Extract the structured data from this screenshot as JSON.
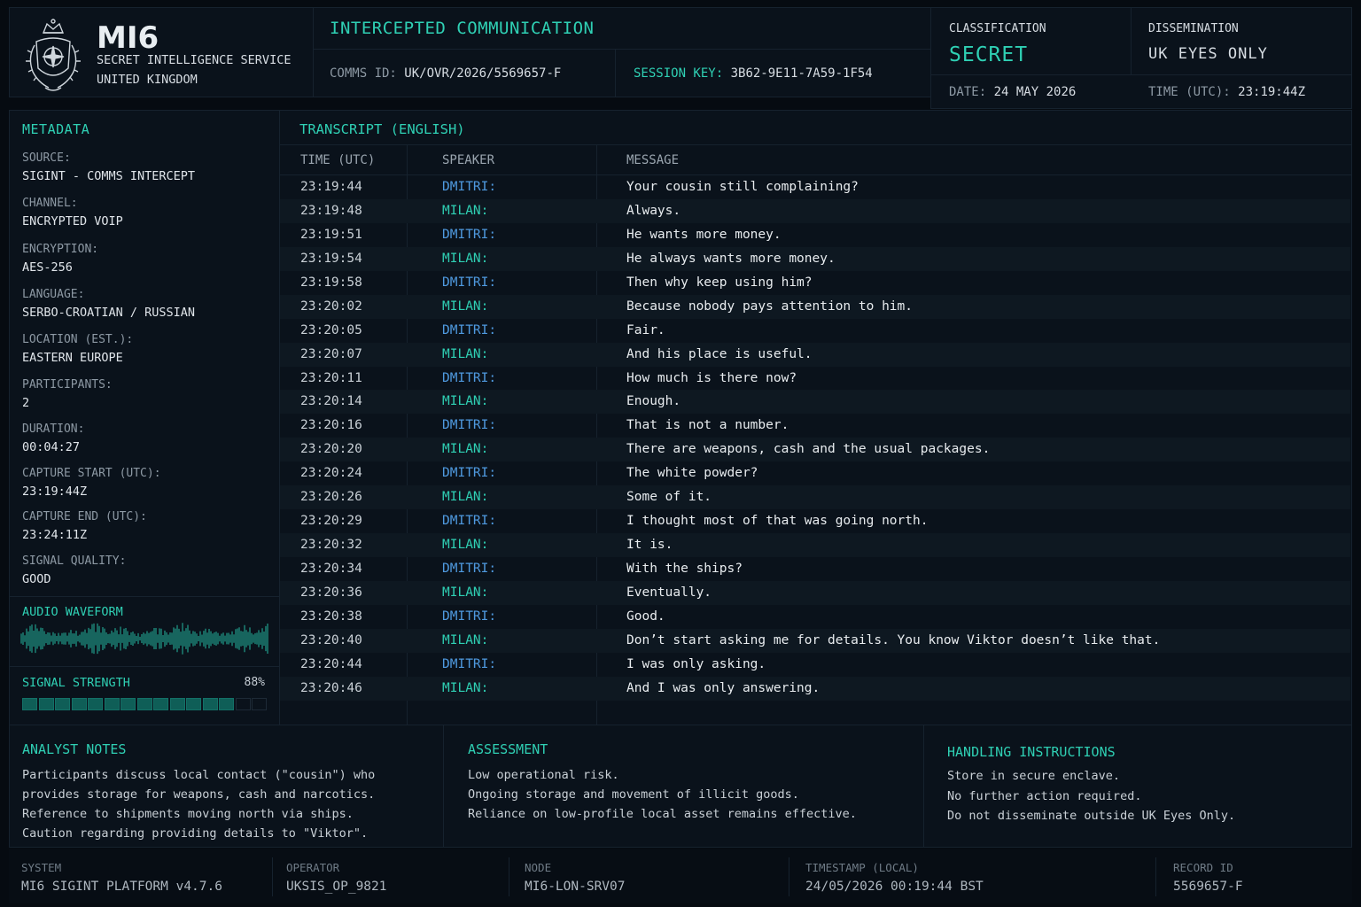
{
  "brand": {
    "name": "MI6",
    "line1": "SECRET INTELLIGENCE SERVICE",
    "line2": "UNITED KINGDOM"
  },
  "intercept": {
    "title": "INTERCEPTED COMMUNICATION",
    "comms_label": "COMMS ID:",
    "comms_value": "UK/OVR/2026/5569657-F",
    "session_label": "SESSION KEY:",
    "session_value": "3B62-9E11-7A59-1F54"
  },
  "classification": {
    "label": "CLASSIFICATION",
    "value": "SECRET",
    "dissem_label": "DISSEMINATION",
    "dissem_value": "UK EYES ONLY",
    "date_label": "DATE:",
    "date_value": "24 MAY 2026",
    "time_label": "TIME (UTC):",
    "time_value": "23:19:44Z"
  },
  "metadata": {
    "title": "METADATA",
    "items": [
      {
        "label": "SOURCE:",
        "value": "SIGINT - COMMS INTERCEPT"
      },
      {
        "label": "CHANNEL:",
        "value": "ENCRYPTED VOIP"
      },
      {
        "label": "ENCRYPTION:",
        "value": "AES-256"
      },
      {
        "label": "LANGUAGE:",
        "value": "SERBO-CROATIAN / RUSSIAN"
      },
      {
        "label": "LOCATION (EST.):",
        "value": "EASTERN EUROPE"
      },
      {
        "label": "PARTICIPANTS:",
        "value": "2"
      },
      {
        "label": "DURATION:",
        "value": "00:04:27"
      },
      {
        "label": "CAPTURE START (UTC):",
        "value": "23:19:44Z"
      },
      {
        "label": "CAPTURE END (UTC):",
        "value": "23:24:11Z"
      },
      {
        "label": "SIGNAL QUALITY:",
        "value": "GOOD"
      }
    ],
    "waveform_title": "AUDIO WAVEFORM",
    "signal_title": "SIGNAL STRENGTH",
    "signal_pct_label": "88%",
    "signal_fraction": 0.88,
    "signal_segments_total": 15,
    "signal_segments_on": 13
  },
  "transcript": {
    "title": "TRANSCRIPT (ENGLISH)",
    "col_time": "TIME (UTC)",
    "col_speaker": "SPEAKER",
    "col_message": "MESSAGE",
    "rows": [
      {
        "time": "23:19:44",
        "speaker": "DMITRI:",
        "msg": "Your cousin still complaining?"
      },
      {
        "time": "23:19:48",
        "speaker": "MILAN:",
        "msg": "Always."
      },
      {
        "time": "23:19:51",
        "speaker": "DMITRI:",
        "msg": "He wants more money."
      },
      {
        "time": "23:19:54",
        "speaker": "MILAN:",
        "msg": "He always wants more money."
      },
      {
        "time": "23:19:58",
        "speaker": "DMITRI:",
        "msg": "Then why keep using him?"
      },
      {
        "time": "23:20:02",
        "speaker": "MILAN:",
        "msg": "Because nobody pays attention to him."
      },
      {
        "time": "23:20:05",
        "speaker": "DMITRI:",
        "msg": "Fair."
      },
      {
        "time": "23:20:07",
        "speaker": "MILAN:",
        "msg": "And his place is useful."
      },
      {
        "time": "23:20:11",
        "speaker": "DMITRI:",
        "msg": "How much is there now?"
      },
      {
        "time": "23:20:14",
        "speaker": "MILAN:",
        "msg": "Enough."
      },
      {
        "time": "23:20:16",
        "speaker": "DMITRI:",
        "msg": "That is not a number."
      },
      {
        "time": "23:20:20",
        "speaker": "MILAN:",
        "msg": "There are weapons, cash and the usual packages."
      },
      {
        "time": "23:20:24",
        "speaker": "DMITRI:",
        "msg": "The white powder?"
      },
      {
        "time": "23:20:26",
        "speaker": "MILAN:",
        "msg": "Some of it."
      },
      {
        "time": "23:20:29",
        "speaker": "DMITRI:",
        "msg": "I thought most of that was going north."
      },
      {
        "time": "23:20:32",
        "speaker": "MILAN:",
        "msg": "It is."
      },
      {
        "time": "23:20:34",
        "speaker": "DMITRI:",
        "msg": "With the ships?"
      },
      {
        "time": "23:20:36",
        "speaker": "MILAN:",
        "msg": "Eventually."
      },
      {
        "time": "23:20:38",
        "speaker": "DMITRI:",
        "msg": "Good."
      },
      {
        "time": "23:20:40",
        "speaker": "MILAN:",
        "msg": "Don’t start asking me for details. You know Viktor doesn’t like that."
      },
      {
        "time": "23:20:44",
        "speaker": "DMITRI:",
        "msg": "I was only asking."
      },
      {
        "time": "23:20:46",
        "speaker": "MILAN:",
        "msg": "And I was only answering."
      }
    ]
  },
  "notes": {
    "title": "ANALYST NOTES",
    "lines": [
      "Participants discuss local contact (\"cousin\") who",
      "provides storage for weapons, cash and narcotics.",
      "Reference to shipments moving north via ships.",
      "Caution regarding providing details to \"Viktor\"."
    ]
  },
  "assessment": {
    "title": "ASSESSMENT",
    "lines": [
      "Low operational risk.",
      "Ongoing storage and movement of illicit goods.",
      "Reliance on low-profile local asset remains effective."
    ]
  },
  "handling": {
    "title": "HANDLING INSTRUCTIONS",
    "lines": [
      "Store in secure enclave.",
      "No further action required.",
      "Do not disseminate outside UK Eyes Only."
    ]
  },
  "footer": [
    {
      "label": "SYSTEM",
      "value": "MI6 SIGINT PLATFORM v4.7.6"
    },
    {
      "label": "OPERATOR",
      "value": "UKSIS_OP_9821"
    },
    {
      "label": "NODE",
      "value": "MI6-LON-SRV07"
    },
    {
      "label": "TIMESTAMP (LOCAL)",
      "value": "24/05/2026 00:19:44 BST"
    },
    {
      "label": "RECORD ID",
      "value": "5569657-F"
    }
  ],
  "colors": {
    "accent": "#2fd0b4",
    "speaker_dmitri": "#4f9ae0",
    "speaker_milan": "#2fd0b4",
    "background": "#060b11"
  }
}
